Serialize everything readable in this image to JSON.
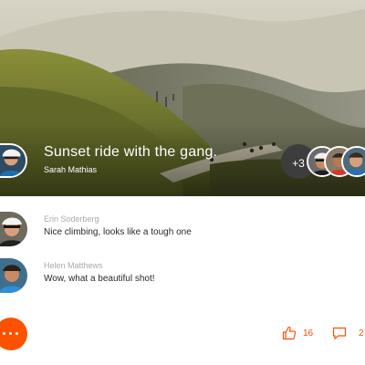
{
  "post": {
    "title": "Sunset ride with the gang.",
    "author": "Sarah Mathias"
  },
  "participants": {
    "more_label": "+3"
  },
  "comments": [
    {
      "name": "Erin Soderberg",
      "text": "Nice climbing, looks like a tough one"
    },
    {
      "name": "Helen Matthews",
      "text": "Wow, what a beautiful shot!"
    }
  ],
  "actions": {
    "kudos_count": "16",
    "comments_count": "2",
    "kudos_icon": "thumbs-up-icon",
    "comment_icon": "speech-bubble-icon",
    "more_icon": "more-dots-icon"
  },
  "colors": {
    "accent": "#fc5200",
    "dark_badge": "#3d3d3d",
    "muted_text": "#a9a9a9"
  }
}
